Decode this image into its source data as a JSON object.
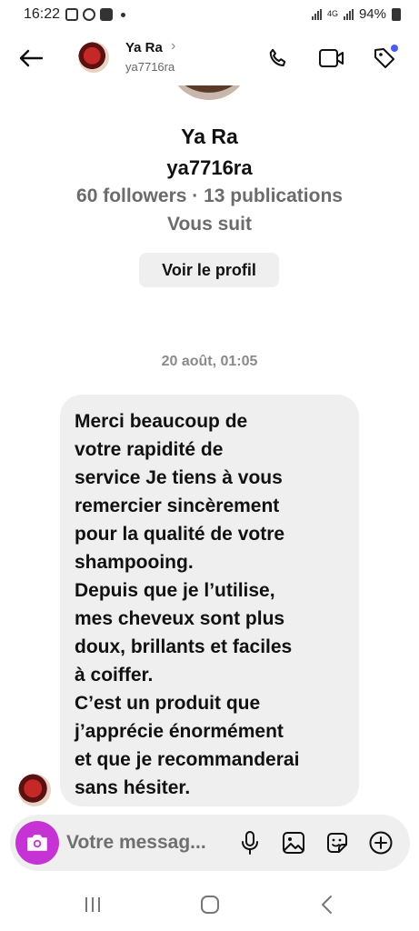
{
  "status_bar": {
    "time": "16:22",
    "network_label": "4G",
    "battery": "94%"
  },
  "header": {
    "name": "Ya Ra",
    "chevron": "›",
    "username": "ya7716ra",
    "icons": [
      "back-arrow-icon",
      "phone-icon",
      "video-camera-icon",
      "tag-icon"
    ],
    "notification_color": "#4a5cf5"
  },
  "profile": {
    "name": "Ya Ra",
    "username": "ya7716ra",
    "stats": "60 followers · 13 publications",
    "follows_you": "Vous suit",
    "view_profile_button": "Voir le profil"
  },
  "conversation": {
    "timestamp": "20 août, 01:05",
    "message": "Merci beaucoup de\nvotre rapidité de\nservice Je tiens à vous\nremercier sincèrement\npour la qualité de votre\nshampooing.\nDepuis que je l’utilise,\nmes cheveux sont plus\ndoux, brillants et faciles\nà coiffer.\nC’est un produit que\nj’apprécie énormément\net que je recommanderai\nsans hésiter."
  },
  "composer": {
    "placeholder": "Votre messag...",
    "camera_color": "#c633d4",
    "icons": [
      "camera-icon",
      "microphone-icon",
      "gallery-icon",
      "sticker-icon",
      "plus-icon"
    ]
  },
  "nav_bar": {
    "icons": [
      "recent-apps-icon",
      "home-icon",
      "back-icon"
    ]
  }
}
